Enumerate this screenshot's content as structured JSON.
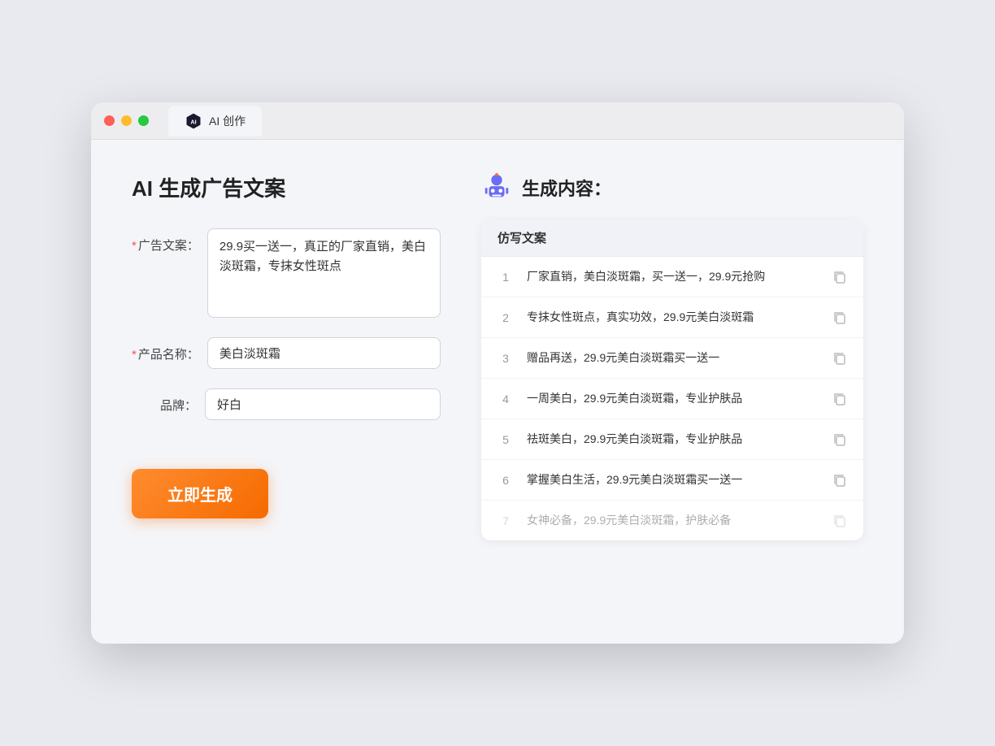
{
  "window": {
    "tab_label": "AI 创作"
  },
  "left_panel": {
    "title": "AI 生成广告文案",
    "form": {
      "ad_copy_label": "广告文案：",
      "ad_copy_required": true,
      "ad_copy_value": "29.9买一送一，真正的厂家直销，美白淡斑霜，专抹女性斑点",
      "product_name_label": "产品名称：",
      "product_name_required": true,
      "product_name_value": "美白淡斑霜",
      "brand_label": "品牌：",
      "brand_required": false,
      "brand_value": "好白",
      "generate_button": "立即生成"
    }
  },
  "right_panel": {
    "title": "生成内容：",
    "table_header": "仿写文案",
    "items": [
      {
        "num": "1",
        "text": "厂家直销，美白淡斑霜，买一送一，29.9元抢购",
        "faded": false
      },
      {
        "num": "2",
        "text": "专抹女性斑点，真实功效，29.9元美白淡斑霜",
        "faded": false
      },
      {
        "num": "3",
        "text": "赠品再送，29.9元美白淡斑霜买一送一",
        "faded": false
      },
      {
        "num": "4",
        "text": "一周美白，29.9元美白淡斑霜，专业护肤品",
        "faded": false
      },
      {
        "num": "5",
        "text": "祛斑美白，29.9元美白淡斑霜，专业护肤品",
        "faded": false
      },
      {
        "num": "6",
        "text": "掌握美白生活，29.9元美白淡斑霜买一送一",
        "faded": false
      },
      {
        "num": "7",
        "text": "女神必备，29.9元美白淡斑霜，护肤必备",
        "faded": true
      }
    ]
  }
}
